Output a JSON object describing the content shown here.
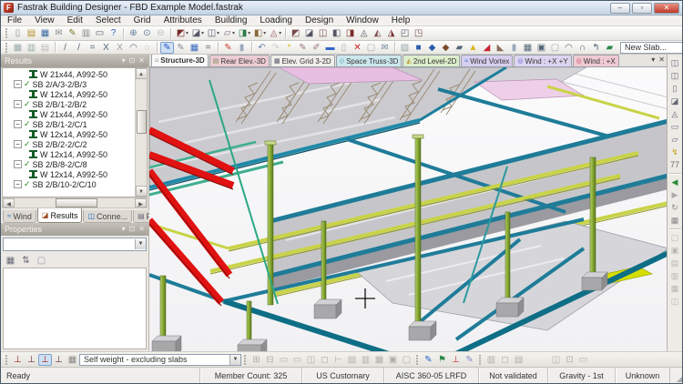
{
  "window": {
    "title": "Fastrak Building Designer - FBD Example Model.fastrak",
    "icon_letter": "F"
  },
  "window_controls": {
    "minimize": "–",
    "restore": "▫",
    "close": "✕"
  },
  "menu": [
    "File",
    "View",
    "Edit",
    "Select",
    "Grid",
    "Attributes",
    "Building",
    "Loading",
    "Design",
    "Window",
    "Help"
  ],
  "toolbar1": {
    "file_icons": [
      {
        "n": "new-icon",
        "g": "▯",
        "c": "#8a8a8a"
      },
      {
        "n": "open-icon",
        "g": "▤",
        "c": "#b8902c"
      },
      {
        "n": "save-icon",
        "g": "▦",
        "c": "#3b6aa0"
      },
      {
        "n": "send-icon",
        "g": "✉",
        "c": "#8a8a8a"
      },
      {
        "n": "edit-doc-icon",
        "g": "✎",
        "c": "#7a7a30"
      },
      {
        "n": "paste-icon",
        "g": "▥",
        "c": "#888888"
      },
      {
        "n": "print-icon",
        "g": "▭",
        "c": "#556"
      },
      {
        "n": "help-icon",
        "g": "?",
        "c": "#2a62c8"
      }
    ],
    "zoom_icons": [
      {
        "n": "zoom-in-icon",
        "g": "⊕",
        "c": "#5a7a9a"
      },
      {
        "n": "zoom-window-icon",
        "g": "⊙",
        "c": "#5a7a9a"
      },
      {
        "n": "zoom-out-icon",
        "g": "⊖",
        "c": "#b8b8b4"
      }
    ],
    "view_cubes": [
      {
        "n": "view-solid-icon",
        "g": "◩",
        "c": "#7a2a2a"
      },
      {
        "n": "view-wire-icon",
        "g": "◪",
        "c": "#556"
      },
      {
        "n": "view-rotate-icon",
        "g": "◫",
        "c": "#556"
      },
      {
        "n": "view-pan-icon",
        "g": "▱",
        "c": "#767"
      },
      {
        "n": "view-render-icon",
        "g": "◨",
        "c": "#2a7a4a"
      },
      {
        "n": "view-walk-icon",
        "g": "◧",
        "c": "#8a6a3a"
      },
      {
        "n": "view-fly-icon",
        "g": "◬",
        "c": "#9a5a6a"
      }
    ],
    "view_cubes_right": [
      {
        "n": "iso-view-1-icon",
        "g": "◩",
        "c": "#7a4a4a"
      },
      {
        "n": "iso-view-2-icon",
        "g": "◪",
        "c": "#556"
      },
      {
        "n": "iso-view-3-icon",
        "g": "◫",
        "c": "#7a4a4a"
      },
      {
        "n": "iso-view-4-icon",
        "g": "◧",
        "c": "#556"
      },
      {
        "n": "iso-view-5-icon",
        "g": "◨",
        "c": "#7a2a2a"
      },
      {
        "n": "iso-view-6-icon",
        "g": "◬",
        "c": "#556"
      },
      {
        "n": "iso-view-7-icon",
        "g": "◭",
        "c": "#7a4a4a"
      },
      {
        "n": "iso-view-8-icon",
        "g": "◮",
        "c": "#7a2a2a"
      },
      {
        "n": "iso-view-9-icon",
        "g": "◰",
        "c": "#556"
      },
      {
        "n": "iso-view-10-icon",
        "g": "◳",
        "c": "#7a4a4a"
      }
    ]
  },
  "toolbar2": {
    "grid_icons": [
      {
        "n": "grid-icon",
        "g": "▦",
        "c": "#9aa"
      },
      {
        "n": "grid-plane-icon",
        "g": "▥",
        "c": "#9aa"
      },
      {
        "n": "grid-sheet-icon",
        "g": "▤",
        "c": "#bbb"
      }
    ],
    "construction_icons": [
      {
        "n": "con-line-icon",
        "g": "/",
        "c": "#567"
      },
      {
        "n": "con-line2-icon",
        "g": "/",
        "c": "#567"
      },
      {
        "n": "con-parallel-icon",
        "g": "=",
        "c": "#567"
      },
      {
        "n": "con-cross-icon",
        "g": "X",
        "c": "#567"
      },
      {
        "n": "con-delete-icon",
        "g": "X",
        "c": "#99a"
      },
      {
        "n": "con-arc-icon",
        "g": "◠",
        "c": "#567"
      },
      {
        "n": "con-circle-icon",
        "g": "◌",
        "c": "#888"
      }
    ],
    "draw_icons": [
      {
        "n": "draw-beam-icon",
        "g": "✎",
        "c": "#2255cc",
        "p": true
      },
      {
        "n": "draw-member-icon",
        "g": "✎",
        "c": "#889"
      },
      {
        "n": "save-view-icon",
        "g": "▦",
        "c": "#3a6ac0"
      },
      {
        "n": "levels-icon",
        "g": "=",
        "c": "#556"
      }
    ],
    "paint_icons": [
      {
        "n": "paint-icon",
        "g": "✎",
        "c": "#c43"
      },
      {
        "n": "block-icon",
        "g": "▮",
        "c": "#9ab"
      }
    ],
    "undo_icons": [
      {
        "n": "undo-icon",
        "g": "↶",
        "c": "#68a"
      },
      {
        "n": "redo-icon",
        "g": "↷",
        "c": "#ccc"
      }
    ],
    "edit_icons": [
      {
        "n": "new-item-icon",
        "g": "*",
        "c": "#d8b81c"
      },
      {
        "n": "edit-item-icon",
        "g": "✎",
        "c": "#977"
      },
      {
        "n": "edit-prop-icon",
        "g": "✐",
        "c": "#977"
      },
      {
        "n": "move-icon",
        "g": "▬",
        "c": "#36c"
      },
      {
        "n": "copy-item-icon",
        "g": "▯",
        "c": "#aaa"
      },
      {
        "n": "delete-icon",
        "g": "✕",
        "c": "#c22"
      },
      {
        "n": "validate-icon",
        "g": "▢",
        "c": "#aaa"
      },
      {
        "n": "report-icon",
        "g": "✉",
        "c": "#789"
      }
    ],
    "structure_icons": [
      {
        "n": "hatch-icon",
        "g": "▨",
        "c": "#9aa"
      },
      {
        "n": "column-tool-icon",
        "g": "■",
        "c": "#2b5cab"
      },
      {
        "n": "beam-tool-icon",
        "g": "◆",
        "c": "#2b5cab"
      },
      {
        "n": "brace-tool-icon",
        "g": "◆",
        "c": "#7a4a2a"
      },
      {
        "n": "wall-tool-icon",
        "g": "▰",
        "c": "#567"
      },
      {
        "n": "warning-icon",
        "g": "▲",
        "c": "#d8b81c"
      },
      {
        "n": "roof-tool-icon",
        "g": "◢",
        "c": "#c23"
      },
      {
        "n": "slope-tool-icon",
        "g": "◣",
        "c": "#8a6a5a"
      },
      {
        "n": "core-tool-icon",
        "g": "▮",
        "c": "#9ab"
      },
      {
        "n": "slab-tool-icon",
        "g": "▦",
        "c": "#567"
      },
      {
        "n": "opening-tool-icon",
        "g": "▣",
        "c": "#567"
      },
      {
        "n": "panel-tool-icon",
        "g": "▢",
        "c": "#9aa"
      },
      {
        "n": "arc-tool-icon",
        "g": "◠",
        "c": "#567"
      },
      {
        "n": "portal-tool-icon",
        "g": "∩",
        "c": "#567"
      },
      {
        "n": "return-tool-icon",
        "g": "↰",
        "c": "#567"
      },
      {
        "n": "truss-tool-icon",
        "g": "▰",
        "c": "#2a8a4a"
      }
    ],
    "new_slab_combo": "New Slab..."
  },
  "view_tabs": [
    {
      "n": "tab-structure-3d",
      "label": "Structure-3D",
      "icon": "⌂",
      "ic": "#334",
      "bg": "#f2f1ee",
      "active": true
    },
    {
      "n": "tab-rear-elev-3d",
      "label": "Rear Elev.-3D",
      "icon": "▤",
      "ic": "#7a8a5a",
      "bg": "#edccd3"
    },
    {
      "n": "tab-elev-grid-3-2d",
      "label": "Elev. Grid 3-2D",
      "icon": "▦",
      "ic": "#556",
      "bg": "#efeeea"
    },
    {
      "n": "tab-space-truss-3d",
      "label": "Space Truss-3D",
      "icon": "◇",
      "ic": "#2a8a9a",
      "bg": "#cde7ee"
    },
    {
      "n": "tab-2nd-level-2d",
      "label": "2nd Level-2D",
      "icon": "◭",
      "ic": "#b8952a",
      "bg": "#dcedcc"
    },
    {
      "n": "tab-wind-vortex",
      "label": "Wind Vortex",
      "icon": "≈",
      "ic": "#1a5acc",
      "bg": "#d6cfee"
    },
    {
      "n": "tab-wind-px-py",
      "label": "Wind : +X +Y",
      "icon": "◎",
      "ic": "#5a5acc",
      "bg": "#dcd5f0"
    },
    {
      "n": "tab-wind-px",
      "label": "Wind : +X",
      "icon": "◎",
      "ic": "#cc4a5a",
      "bg": "#efcad3"
    }
  ],
  "view_tab_controls": {
    "menu": "▾",
    "close": "✕"
  },
  "results_panel": {
    "title": "Results",
    "controls": {
      "menu": "▾",
      "pin": "⊡",
      "close": "✕"
    },
    "glyphs": {
      "expander": "−",
      "check": "✓"
    },
    "tree": [
      {
        "type": "beam",
        "label": "W 21x44, A992-50"
      },
      {
        "type": "group",
        "label": "SB 2/A/3-2/B/3"
      },
      {
        "type": "beam",
        "label": "W 12x14, A992-50"
      },
      {
        "type": "group",
        "label": "SB 2/B/1-2/B/2"
      },
      {
        "type": "beam",
        "label": "W 21x44, A992-50"
      },
      {
        "type": "group",
        "label": "SB 2/B/1-2/C/1"
      },
      {
        "type": "beam",
        "label": "W 12x14, A992-50"
      },
      {
        "type": "group",
        "label": "SB 2/B/2-2/C/2"
      },
      {
        "type": "beam",
        "label": "W 12x14, A992-50"
      },
      {
        "type": "group",
        "label": "SB 2/B/8-2/C/8"
      },
      {
        "type": "beam",
        "label": "W 12x14, A992-50"
      },
      {
        "type": "group",
        "label": "SB 2/B/10-2/C/10"
      }
    ],
    "bottom_tabs": [
      {
        "n": "panel-tab-wind",
        "label": "Wind",
        "icon": "≈",
        "ic": "#2266cc"
      },
      {
        "n": "panel-tab-results",
        "label": "Results",
        "icon": "◪",
        "ic": "#a2522a",
        "active": true
      },
      {
        "n": "panel-tab-connections",
        "label": "Conne...",
        "icon": "◫",
        "ic": "#2266cc"
      },
      {
        "n": "panel-tab-project",
        "label": "Project",
        "icon": "▤",
        "ic": "#667"
      }
    ]
  },
  "properties_panel": {
    "title": "Properties",
    "controls": {
      "menu": "▾",
      "pin": "⊡",
      "close": "✕"
    },
    "combo_value": "",
    "icons": [
      {
        "n": "categorized-icon",
        "g": "▦",
        "c": "#667"
      },
      {
        "n": "sort-az-icon",
        "g": "⇅",
        "c": "#667"
      },
      {
        "n": "property-pages-icon",
        "g": "▢",
        "c": "#99a"
      }
    ]
  },
  "right_toolbar": {
    "g1": [
      {
        "n": "beam-section-icon",
        "g": "◫",
        "c": "#667"
      },
      {
        "n": "column-section-icon",
        "g": "◫",
        "c": "#667"
      },
      {
        "n": "brace-section-icon",
        "g": "▯",
        "c": "#667"
      },
      {
        "n": "plate-section-icon",
        "g": "◪",
        "c": "#667"
      },
      {
        "n": "truss-section-icon",
        "g": "◬",
        "c": "#667"
      },
      {
        "n": "joist-section-icon",
        "g": "▭",
        "c": "#667"
      },
      {
        "n": "deck-section-icon",
        "g": "▱",
        "c": "#667"
      },
      {
        "n": "bolt-icon",
        "g": "↯",
        "c": "#c8a018"
      },
      {
        "n": "grade-77-icon",
        "g": "77",
        "c": "#666"
      }
    ],
    "g2": [
      {
        "n": "prev-icon",
        "g": "◀",
        "c": "#2a8a3a"
      },
      {
        "n": "next-icon",
        "g": "▶",
        "c": "#aaa"
      },
      {
        "n": "refresh-icon",
        "g": "↻",
        "c": "#888"
      },
      {
        "n": "details-icon",
        "g": "▦",
        "c": "#888"
      }
    ],
    "g3": [
      {
        "n": "check-panel-icon",
        "g": "▢",
        "c": "#b8b6b0"
      },
      {
        "n": "design-panel-icon",
        "g": "▣",
        "c": "#b8b6b0"
      },
      {
        "n": "review-panel-icon",
        "g": "▤",
        "c": "#b8b6b0"
      },
      {
        "n": "report-panel-icon",
        "g": "▥",
        "c": "#b8b6b0"
      },
      {
        "n": "export-panel-icon",
        "g": "▦",
        "c": "#b8b6b0"
      },
      {
        "n": "drawing-panel-icon",
        "g": "◫",
        "c": "#b8b6b0"
      }
    ]
  },
  "bottom_toolbar": {
    "loadcase_icons": [
      {
        "n": "loadcase-1-icon",
        "g": "⊥",
        "c": "#a22"
      },
      {
        "n": "loadcase-2-icon",
        "g": "⊥",
        "c": "#633"
      },
      {
        "n": "loadcase-3-icon",
        "g": "⊥",
        "c": "#a22",
        "p": true
      },
      {
        "n": "loadcase-4-icon",
        "g": "⊥",
        "c": "#633"
      },
      {
        "n": "loadcase-grid-icon",
        "g": "▦",
        "c": "#888"
      }
    ],
    "loadcase_combo": "Self weight - excluding slabs",
    "analysis_icons": [
      {
        "n": "load-plan-icon",
        "g": "⊞",
        "c": "#b0aeaa"
      },
      {
        "n": "load-elev-icon",
        "g": "⊟",
        "c": "#b0aeaa"
      },
      {
        "n": "load-area-icon",
        "g": "▭",
        "c": "#b0aeaa"
      },
      {
        "n": "load-line-icon",
        "g": "▭",
        "c": "#b0aeaa"
      },
      {
        "n": "load-point-icon",
        "g": "◫",
        "c": "#b0aeaa"
      },
      {
        "n": "load-patch-icon",
        "g": "◻",
        "c": "#b0aeaa"
      },
      {
        "n": "load-perp-icon",
        "g": "⊢",
        "c": "#b0aeaa"
      },
      {
        "n": "load-table-icon",
        "g": "▤",
        "c": "#b0aeaa"
      },
      {
        "n": "load-sheet-icon",
        "g": "▥",
        "c": "#b0aeaa"
      },
      {
        "n": "load-grid2-icon",
        "g": "▦",
        "c": "#b0aeaa"
      },
      {
        "n": "load-box-icon",
        "g": "▣",
        "c": "#b0aeaa"
      },
      {
        "n": "load-cell-icon",
        "g": "▢",
        "c": "#b0aeaa"
      }
    ],
    "review_icons": [
      {
        "n": "annotate-icon",
        "g": "✎",
        "c": "#2266cc"
      },
      {
        "n": "flag-icon",
        "g": "⚑",
        "c": "#2a8a4a"
      },
      {
        "n": "support-icon",
        "g": "⊥",
        "c": "#c33"
      },
      {
        "n": "marker-icon",
        "g": "✎",
        "c": "#88c"
      }
    ],
    "misc_icons": [
      {
        "n": "snapshot-icon",
        "g": "▥",
        "c": "#b0aeaa"
      },
      {
        "n": "frame-icon",
        "g": "◻",
        "c": "#b0aeaa"
      },
      {
        "n": "layout-icon",
        "g": "▤",
        "c": "#b0aeaa"
      }
    ],
    "far_icons": [
      {
        "n": "sync-icon",
        "g": "◫",
        "c": "#b0aeaa"
      },
      {
        "n": "lock-view-icon",
        "g": "⊡",
        "c": "#b0aeaa"
      },
      {
        "n": "archive-icon",
        "g": "▭",
        "c": "#b0aeaa"
      }
    ]
  },
  "status_bar": {
    "ready": "Ready",
    "member_count": "Member Count: 325",
    "units": "US Customary",
    "design_code": "AISC 360-05 LRFD",
    "validation": "Not validated",
    "loading": "Gravity - 1st",
    "state": "Unknown"
  },
  "model_palette": {
    "slab_gray": "#cbcbcf",
    "beam_teal": "#1f7c99",
    "beam_teal_dark": "#0e6e86",
    "beam_yellow_green": "#c9d347",
    "column_green": "#86a832",
    "brace_red": "#e11212",
    "slab_pink": "#e6bfe2",
    "footing_gray": "#a8a8aa",
    "highlight_yellow": "#d6de00"
  }
}
